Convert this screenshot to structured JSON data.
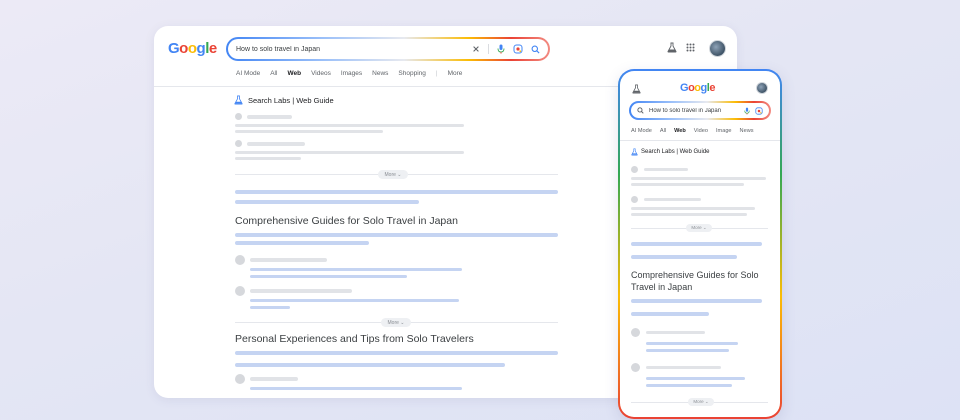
{
  "brand": {
    "logo_letters": [
      "G",
      "o",
      "o",
      "g",
      "l",
      "e"
    ]
  },
  "desktop": {
    "search_query": "How to solo travel in Japan",
    "tabs": [
      "AI Mode",
      "All",
      "Web",
      "Videos",
      "Images",
      "News",
      "Shopping",
      "More"
    ],
    "active_tab": "Web",
    "labs_title": "Search Labs | Web Guide",
    "section1_heading": "Comprehensive Guides for Solo Travel in Japan",
    "section2_heading": "Personal Experiences and Tips from Solo Travelers",
    "more_label": "More"
  },
  "mobile": {
    "search_query": "How to solo travel in Japan",
    "tabs": [
      "AI Mode",
      "All",
      "Web",
      "Video",
      "Image",
      "News"
    ],
    "active_tab": "Web",
    "labs_title": "Search Labs | Web Guide",
    "section1_heading": "Comprehensive Guides for Solo Travel in Japan",
    "more_label": "More"
  },
  "icons": [
    "close-icon",
    "mic-icon",
    "lens-icon",
    "search-icon",
    "labs-flask-icon",
    "apps-grid-icon",
    "avatar"
  ],
  "colors": {
    "accent_blue": "#4285f4",
    "accent_red": "#ea4335",
    "accent_yellow": "#fbbc05",
    "accent_green": "#34a853",
    "placeholder_blue": "#c5d4f2",
    "placeholder_grey": "#e1e3e7"
  }
}
